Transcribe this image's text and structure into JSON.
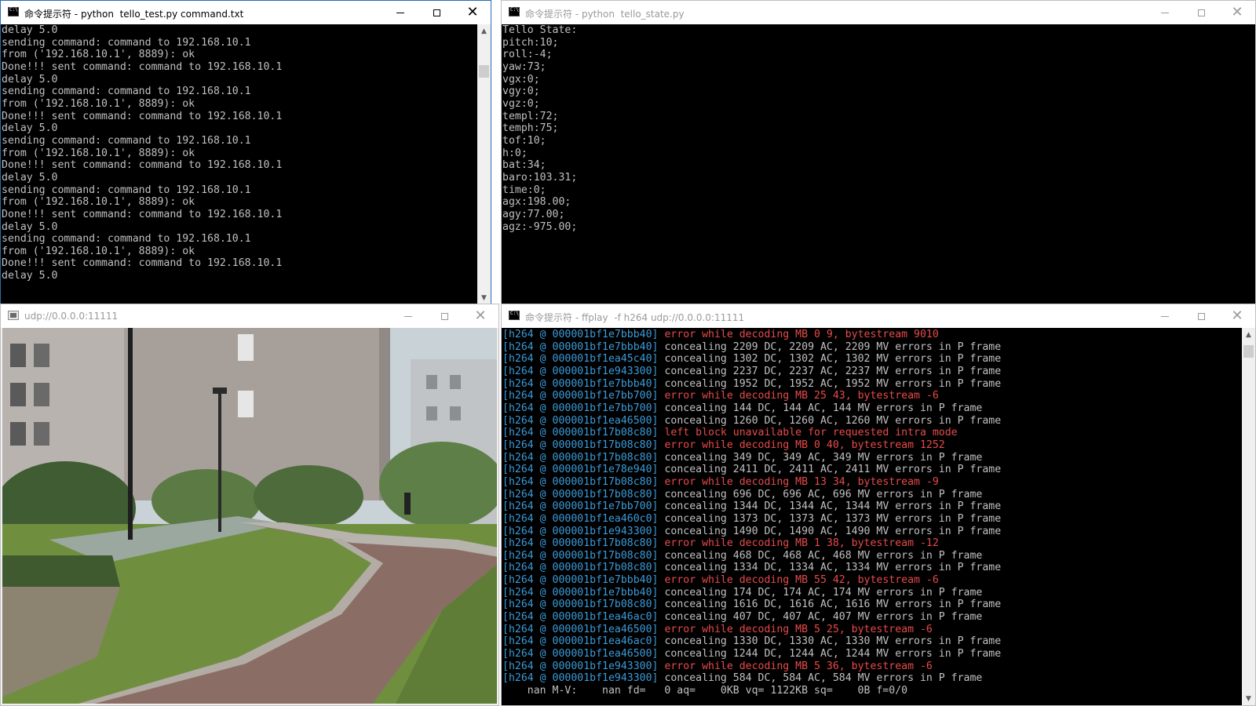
{
  "windows": {
    "test": {
      "title": "命令提示符 - python  tello_test.py command.txt",
      "lines": [
        "delay 5.0",
        "sending command: command to 192.168.10.1",
        "from ('192.168.10.1', 8889): ok",
        "Done!!! sent command: command to 192.168.10.1",
        "delay 5.0",
        "sending command: command to 192.168.10.1",
        "from ('192.168.10.1', 8889): ok",
        "Done!!! sent command: command to 192.168.10.1",
        "delay 5.0",
        "sending command: command to 192.168.10.1",
        "from ('192.168.10.1', 8889): ok",
        "Done!!! sent command: command to 192.168.10.1",
        "delay 5.0",
        "sending command: command to 192.168.10.1",
        "from ('192.168.10.1', 8889): ok",
        "Done!!! sent command: command to 192.168.10.1",
        "delay 5.0",
        "sending command: command to 192.168.10.1",
        "from ('192.168.10.1', 8889): ok",
        "Done!!! sent command: command to 192.168.10.1",
        "delay 5.0"
      ]
    },
    "state": {
      "title": "命令提示符 - python  tello_state.py",
      "lines": [
        "Tello State:",
        "pitch:10;",
        "roll:-4;",
        "yaw:73;",
        "vgx:0;",
        "vgy:0;",
        "vgz:0;",
        "templ:72;",
        "temph:75;",
        "tof:10;",
        "h:0;",
        "bat:34;",
        "baro:103.31;",
        "time:0;",
        "agx:198.00;",
        "agy:77.00;",
        "agz:-975.00;"
      ]
    },
    "video": {
      "title": "udp://0.0.0.0:11111"
    },
    "ffplay": {
      "title": "命令提示符 - ffplay  -f h264 udp://0.0.0.0:11111",
      "rows": [
        {
          "prefix": "[h264 @ 000001bf1e7bbb40]",
          "msg": "error while decoding MB 0 9, bytestream 9010",
          "kind": "red"
        },
        {
          "prefix": "[h264 @ 000001bf1e7bbb40]",
          "msg": "concealing 2209 DC, 2209 AC, 2209 MV errors in P frame",
          "kind": "grey"
        },
        {
          "prefix": "[h264 @ 000001bf1ea45c40]",
          "msg": "concealing 1302 DC, 1302 AC, 1302 MV errors in P frame",
          "kind": "grey"
        },
        {
          "prefix": "[h264 @ 000001bf1e943300]",
          "msg": "concealing 2237 DC, 2237 AC, 2237 MV errors in P frame",
          "kind": "grey"
        },
        {
          "prefix": "[h264 @ 000001bf1e7bbb40]",
          "msg": "concealing 1952 DC, 1952 AC, 1952 MV errors in P frame",
          "kind": "grey"
        },
        {
          "prefix": "[h264 @ 000001bf1e7bb700]",
          "msg": "error while decoding MB 25 43, bytestream -6",
          "kind": "red"
        },
        {
          "prefix": "[h264 @ 000001bf1e7bb700]",
          "msg": "concealing 144 DC, 144 AC, 144 MV errors in P frame",
          "kind": "grey"
        },
        {
          "prefix": "[h264 @ 000001bf1ea46500]",
          "msg": "concealing 1260 DC, 1260 AC, 1260 MV errors in P frame",
          "kind": "grey"
        },
        {
          "prefix": "[h264 @ 000001bf17b08c80]",
          "msg": "left block unavailable for requested intra mode",
          "kind": "red"
        },
        {
          "prefix": "[h264 @ 000001bf17b08c80]",
          "msg": "error while decoding MB 0 40, bytestream 1252",
          "kind": "red"
        },
        {
          "prefix": "[h264 @ 000001bf17b08c80]",
          "msg": "concealing 349 DC, 349 AC, 349 MV errors in P frame",
          "kind": "grey"
        },
        {
          "prefix": "[h264 @ 000001bf1e78e940]",
          "msg": "concealing 2411 DC, 2411 AC, 2411 MV errors in P frame",
          "kind": "grey"
        },
        {
          "prefix": "[h264 @ 000001bf17b08c80]",
          "msg": "error while decoding MB 13 34, bytestream -9",
          "kind": "red"
        },
        {
          "prefix": "[h264 @ 000001bf17b08c80]",
          "msg": "concealing 696 DC, 696 AC, 696 MV errors in P frame",
          "kind": "grey"
        },
        {
          "prefix": "[h264 @ 000001bf1e7bb700]",
          "msg": "concealing 1344 DC, 1344 AC, 1344 MV errors in P frame",
          "kind": "grey"
        },
        {
          "prefix": "[h264 @ 000001bf1ea460c0]",
          "msg": "concealing 1373 DC, 1373 AC, 1373 MV errors in P frame",
          "kind": "grey"
        },
        {
          "prefix": "[h264 @ 000001bf1e943300]",
          "msg": "concealing 1490 DC, 1490 AC, 1490 MV errors in P frame",
          "kind": "grey"
        },
        {
          "prefix": "[h264 @ 000001bf17b08c80]",
          "msg": "error while decoding MB 1 38, bytestream -12",
          "kind": "red"
        },
        {
          "prefix": "[h264 @ 000001bf17b08c80]",
          "msg": "concealing 468 DC, 468 AC, 468 MV errors in P frame",
          "kind": "grey"
        },
        {
          "prefix": "[h264 @ 000001bf17b08c80]",
          "msg": "concealing 1334 DC, 1334 AC, 1334 MV errors in P frame",
          "kind": "grey"
        },
        {
          "prefix": "[h264 @ 000001bf1e7bbb40]",
          "msg": "error while decoding MB 55 42, bytestream -6",
          "kind": "red"
        },
        {
          "prefix": "[h264 @ 000001bf1e7bbb40]",
          "msg": "concealing 174 DC, 174 AC, 174 MV errors in P frame",
          "kind": "grey"
        },
        {
          "prefix": "[h264 @ 000001bf17b08c80]",
          "msg": "concealing 1616 DC, 1616 AC, 1616 MV errors in P frame",
          "kind": "grey"
        },
        {
          "prefix": "[h264 @ 000001bf1ea46ac0]",
          "msg": "concealing 407 DC, 407 AC, 407 MV errors in P frame",
          "kind": "grey"
        },
        {
          "prefix": "[h264 @ 000001bf1ea46500]",
          "msg": "error while decoding MB 5 25, bytestream -6",
          "kind": "red"
        },
        {
          "prefix": "[h264 @ 000001bf1ea46ac0]",
          "msg": "concealing 1330 DC, 1330 AC, 1330 MV errors in P frame",
          "kind": "grey"
        },
        {
          "prefix": "[h264 @ 000001bf1ea46500]",
          "msg": "concealing 1244 DC, 1244 AC, 1244 MV errors in P frame",
          "kind": "grey"
        },
        {
          "prefix": "[h264 @ 000001bf1e943300]",
          "msg": "error while decoding MB 5 36, bytestream -6",
          "kind": "red"
        },
        {
          "prefix": "[h264 @ 000001bf1e943300]",
          "msg": "concealing 584 DC, 584 AC, 584 MV errors in P frame",
          "kind": "grey"
        }
      ],
      "status_line": "    nan M-V:    nan fd=   0 aq=    0KB vq= 1122KB sq=    0B f=0/0"
    }
  },
  "colors": {
    "error_red": "#e84a4a",
    "prefix_blue": "#3b9bd9",
    "console_text": "#c0c0c0"
  }
}
